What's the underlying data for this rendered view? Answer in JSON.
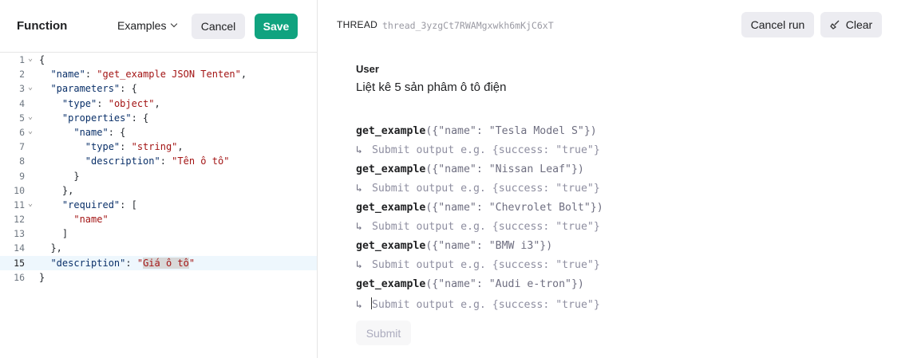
{
  "left": {
    "title": "Function",
    "examples_label": "Examples",
    "cancel_label": "Cancel",
    "save_label": "Save"
  },
  "code": {
    "lines": [
      {
        "n": "1",
        "fold": true,
        "parts": [
          [
            "p",
            "{"
          ]
        ]
      },
      {
        "n": "2",
        "fold": false,
        "parts": [
          [
            "p",
            "  "
          ],
          [
            "k",
            "\"name\""
          ],
          [
            "p",
            ": "
          ],
          [
            "s",
            "\"get_example JSON Tenten\""
          ],
          [
            "p",
            ","
          ]
        ]
      },
      {
        "n": "3",
        "fold": true,
        "parts": [
          [
            "p",
            "  "
          ],
          [
            "k",
            "\"parameters\""
          ],
          [
            "p",
            ": {"
          ]
        ]
      },
      {
        "n": "4",
        "fold": false,
        "parts": [
          [
            "p",
            "    "
          ],
          [
            "k",
            "\"type\""
          ],
          [
            "p",
            ": "
          ],
          [
            "s",
            "\"object\""
          ],
          [
            "p",
            ","
          ]
        ]
      },
      {
        "n": "5",
        "fold": true,
        "parts": [
          [
            "p",
            "    "
          ],
          [
            "k",
            "\"properties\""
          ],
          [
            "p",
            ": {"
          ]
        ]
      },
      {
        "n": "6",
        "fold": true,
        "parts": [
          [
            "p",
            "      "
          ],
          [
            "k",
            "\"name\""
          ],
          [
            "p",
            ": {"
          ]
        ]
      },
      {
        "n": "7",
        "fold": false,
        "parts": [
          [
            "p",
            "        "
          ],
          [
            "k",
            "\"type\""
          ],
          [
            "p",
            ": "
          ],
          [
            "s",
            "\"string\""
          ],
          [
            "p",
            ","
          ]
        ]
      },
      {
        "n": "8",
        "fold": false,
        "parts": [
          [
            "p",
            "        "
          ],
          [
            "k",
            "\"description\""
          ],
          [
            "p",
            ": "
          ],
          [
            "s",
            "\"Tên ô tô\""
          ]
        ]
      },
      {
        "n": "9",
        "fold": false,
        "parts": [
          [
            "p",
            "      }"
          ]
        ]
      },
      {
        "n": "10",
        "fold": false,
        "parts": [
          [
            "p",
            "    },"
          ]
        ]
      },
      {
        "n": "11",
        "fold": true,
        "parts": [
          [
            "p",
            "    "
          ],
          [
            "k",
            "\"required\""
          ],
          [
            "p",
            ": ["
          ]
        ]
      },
      {
        "n": "12",
        "fold": false,
        "parts": [
          [
            "p",
            "      "
          ],
          [
            "s",
            "\"name\""
          ]
        ]
      },
      {
        "n": "13",
        "fold": false,
        "parts": [
          [
            "p",
            "    ]"
          ]
        ]
      },
      {
        "n": "14",
        "fold": false,
        "parts": [
          [
            "p",
            "  },"
          ]
        ]
      },
      {
        "n": "15",
        "fold": false,
        "active": true,
        "parts": [
          [
            "p",
            "  "
          ],
          [
            "k",
            "\"description\""
          ],
          [
            "p",
            ": "
          ],
          [
            "s",
            "\""
          ],
          [
            "h",
            "Giá ô tô"
          ],
          [
            "s",
            "\""
          ]
        ]
      },
      {
        "n": "16",
        "fold": false,
        "parts": [
          [
            "p",
            "}"
          ]
        ]
      }
    ]
  },
  "thread": {
    "label": "THREAD",
    "id": "thread_3yzgCt7RWAMgxwkh6mKjC6xT",
    "cancel_run_label": "Cancel run",
    "clear_label": "Clear"
  },
  "user": {
    "label": "User",
    "message": "Liệt kê 5 sản phâm ô tô điện"
  },
  "calls": [
    {
      "fname": "get_example",
      "args": "({\"name\": \"Tesla Model S\"})",
      "output": "Submit output e.g. {success: \"true\"}"
    },
    {
      "fname": "get_example",
      "args": "({\"name\": \"Nissan Leaf\"})",
      "output": "Submit output e.g. {success: \"true\"}"
    },
    {
      "fname": "get_example",
      "args": "({\"name\": \"Chevrolet Bolt\"})",
      "output": "Submit output e.g. {success: \"true\"}"
    },
    {
      "fname": "get_example",
      "args": "({\"name\": \"BMW i3\"})",
      "output": "Submit output e.g. {success: \"true\"}"
    },
    {
      "fname": "get_example",
      "args": "({\"name\": \"Audi e-tron\"})",
      "output": "Submit output e.g. {success: \"true\"}",
      "focused": true
    }
  ],
  "submit_label": "Submit",
  "arrow_glyph": "↳",
  "colors": {
    "save": "#10a37f",
    "button_bg": "#ececf1",
    "active_line": "#eef7fd"
  }
}
